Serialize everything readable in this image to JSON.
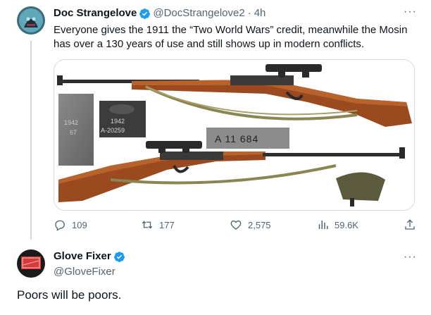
{
  "tweet": {
    "author_name": "Doc Strangelove",
    "author_handle": "@DocStrangelove2",
    "separator": "·",
    "time": "4h",
    "text": "Everyone gives the 1911 the “Two World Wars” credit, meanwhile the Mosin has over a 130 years of use and still shows up in modern conflicts.",
    "more_label": "···",
    "media": {
      "alt": "Two Mosin-Nagant sniper rifles with scopes, sling and close-ups of stamped markings",
      "stamp_marking": "A 11 684",
      "receiver_marking_year": "1942",
      "receiver_marking_serial": "A-20259",
      "side_marking_year": "1942",
      "side_marking_number": "67"
    },
    "metrics": {
      "replies": "109",
      "retweets": "177",
      "likes": "2,575",
      "views": "59.6K"
    }
  },
  "reply": {
    "author_name": "Glove Fixer",
    "author_handle": "@GloveFixer",
    "more_label": "···",
    "text": "Poors will be poors."
  },
  "colors": {
    "verified": "#1d9bf0",
    "secondary_text": "#536471",
    "border": "#cfd9de"
  }
}
